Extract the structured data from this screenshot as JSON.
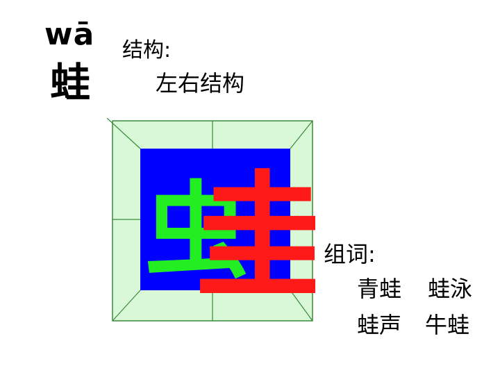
{
  "pinyin": "wā",
  "character": "蛙",
  "structure": {
    "label": "结构:",
    "value": "左右结构"
  },
  "grid": {
    "left_component": "虫",
    "right_component": "圭",
    "colors": {
      "outer_fill": "#d8f8d8",
      "inner_fill": "#0000ff",
      "line": "#3a8a3a",
      "left_component": "#22ee22",
      "right_component": "#ff1a1a"
    }
  },
  "words": {
    "label": "组词:",
    "items": [
      "青蛙",
      "蛙泳",
      "蛙声",
      "牛蛙"
    ]
  }
}
